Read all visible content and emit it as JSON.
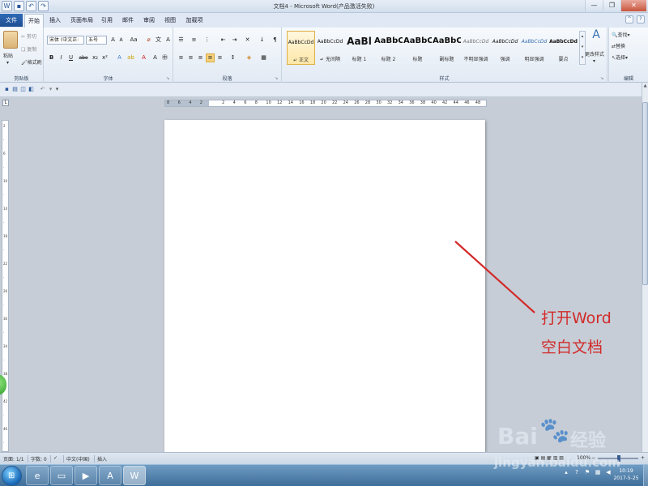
{
  "window": {
    "title": "文档4 - Microsoft Word(产品激活失败)",
    "qat_icons": [
      "word-icon",
      "save-icon",
      "undo-icon",
      "redo-icon"
    ]
  },
  "tabs": {
    "file": "文件",
    "items": [
      "开始",
      "插入",
      "页面布局",
      "引用",
      "邮件",
      "审阅",
      "视图",
      "加载项"
    ],
    "active": "开始"
  },
  "clipboard": {
    "paste": "粘贴",
    "cut": "剪切",
    "copy": "复制",
    "format_painter": "格式刷",
    "label": "剪贴板"
  },
  "font": {
    "font_name": "宋体 (中文正:",
    "font_size": "五号",
    "label": "字体",
    "buttons": [
      "B",
      "I",
      "U",
      "abe",
      "x₂",
      "x²"
    ]
  },
  "paragraph": {
    "label": "段落"
  },
  "styles": {
    "label": "样式",
    "items": [
      {
        "sample": "AaBbCcDd",
        "name": "↵ 正文",
        "selected": true
      },
      {
        "sample": "AaBbCcDd",
        "name": "↵ 无间隔",
        "selected": false
      },
      {
        "sample": "AaBl",
        "name": "标题 1",
        "selected": false
      },
      {
        "sample": "AaBbC",
        "name": "标题 2",
        "selected": false
      },
      {
        "sample": "AaBbC",
        "name": "标题",
        "selected": false
      },
      {
        "sample": "AaBbC",
        "name": "副标题",
        "selected": false
      },
      {
        "sample": "AaBbCcDd",
        "name": "不明显强调",
        "selected": false
      },
      {
        "sample": "AaBbCcDd",
        "name": "强调",
        "selected": false
      },
      {
        "sample": "AaBbCcDd",
        "name": "明显强调",
        "selected": false
      },
      {
        "sample": "AaBbCcDd",
        "name": "要点",
        "selected": false
      }
    ],
    "change_styles": "更改样式"
  },
  "editing": {
    "label": "编辑",
    "find": "查找",
    "replace": "替换",
    "select": "选择"
  },
  "ruler": {
    "numbers": [
      "8",
      "6",
      "4",
      "2",
      "",
      "2",
      "4",
      "6",
      "8",
      "10",
      "12",
      "14",
      "16",
      "18",
      "20",
      "22",
      "24",
      "26",
      "28",
      "30",
      "32",
      "34",
      "36",
      "38",
      "40",
      "42",
      "44",
      "46",
      "48"
    ]
  },
  "annotation": {
    "line1": "打开Word",
    "line2": "空白文档",
    "color": "#d22a2a"
  },
  "statusbar": {
    "page": "页面: 1/1",
    "words": "字数: 0",
    "language": "中文(中国)",
    "mode": "插入",
    "zoom": "100%"
  },
  "taskbar": {
    "apps": [
      "ie-icon",
      "explorer-icon",
      "media-icon",
      "acrobat-icon",
      "word-icon"
    ],
    "active_app": "word-icon",
    "time": "10:19",
    "date": "2017-5-25"
  },
  "watermark": {
    "brand": "Bai",
    "brand2": "经验",
    "url": "jingyan.baidu.com"
  }
}
